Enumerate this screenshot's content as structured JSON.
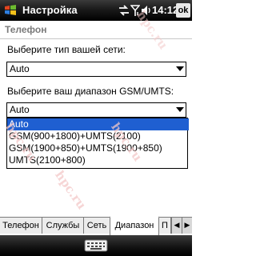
{
  "titlebar": {
    "title": "Настройка",
    "time": "14:12",
    "ok_label": "ok",
    "icons": [
      "windows-start-icon",
      "sync-icon",
      "signal-icon",
      "volume-icon"
    ]
  },
  "page": {
    "title": "Телефон"
  },
  "network": {
    "label": "Выберите тип вашей сети:",
    "value": "Auto"
  },
  "band": {
    "label": "Выберите ваш диапазон GSM/UMTS:",
    "value": "Auto",
    "options": [
      "Auto",
      "GSM(900+1800)+UMTS(2100)",
      "GSM(1900+850)+UMTS(1900+850)",
      "UMTS(2100+800)"
    ],
    "selected_index": 0
  },
  "tabs": [
    "Телефон",
    "Службы",
    "Сеть",
    "Диапазон",
    "П"
  ],
  "active_tab_index": 3,
  "watermark": "hpc.ru",
  "colors": {
    "selection": "#1f5fd1",
    "title_bar": "#000000",
    "header_text": "#7a7a7a"
  }
}
